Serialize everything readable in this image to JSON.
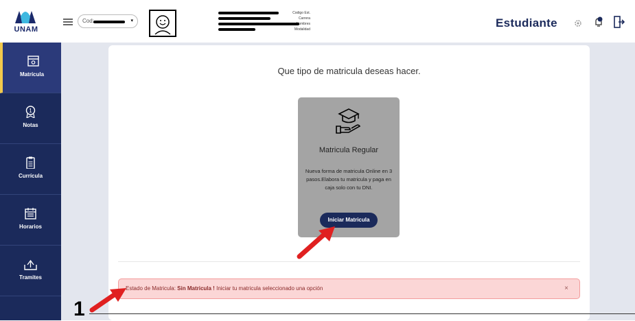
{
  "header": {
    "logo_text": "UNAM",
    "cod_label": "Cod:",
    "info_labels": [
      "Codigo Est.",
      "Carrera",
      "Nombres",
      "Modalidad"
    ],
    "role_title": "Estudiante",
    "icons": [
      "gear-icon",
      "bell-icon",
      "logout-icon"
    ]
  },
  "sidebar": {
    "items": [
      {
        "label": "Matrícula",
        "icon": "calendar-icon",
        "active": true
      },
      {
        "label": "Notas",
        "icon": "medal-icon",
        "active": false
      },
      {
        "label": "Currícula",
        "icon": "clipboard-icon",
        "active": false
      },
      {
        "label": "Horarios",
        "icon": "schedule-icon",
        "active": false
      },
      {
        "label": "Tramites",
        "icon": "inbox-icon",
        "active": false
      }
    ]
  },
  "main": {
    "question": "Que tipo de matricula deseas hacer.",
    "option": {
      "title": "Matricula Regular",
      "description": "Nueva forma de matricula Online en 3 pasos.Elabora tu matricula y paga en caja solo con tu DNI.",
      "button_label": "Iniciar Matricula"
    },
    "alert": {
      "prefix": "Estado de Matricula:",
      "status": "Sin Matricula !",
      "message": "Iniciar tu matricula seleccionado una opción",
      "close": "×"
    }
  },
  "annotation": {
    "number": "1"
  },
  "colors": {
    "navy": "#1b2a5b",
    "accent": "#f2c94c",
    "alert_bg": "#fbd6d6",
    "arrow": "#e02020"
  }
}
